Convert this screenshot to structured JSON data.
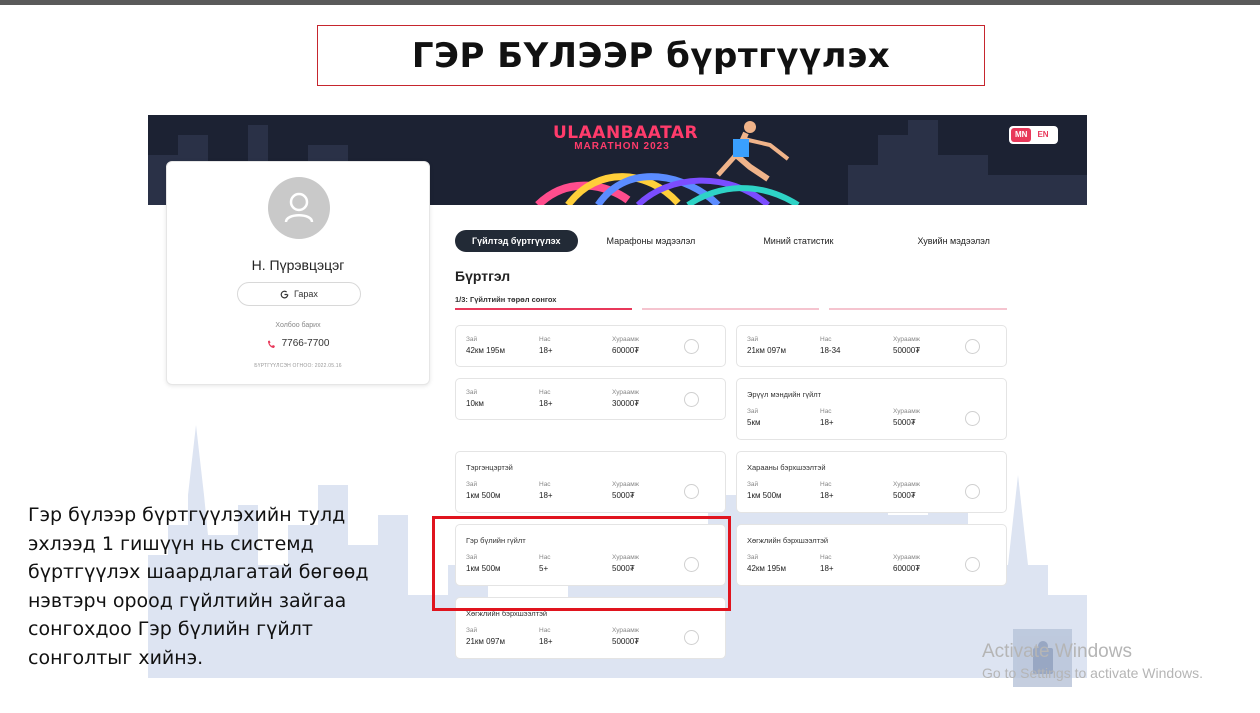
{
  "slide": {
    "title": "ГЭР БҮЛЭЭР бүртгүүлэх",
    "description": "Гэр бүлээр бүртгүүлэхийн тулд эхлээд 1 гишүүн нь системд бүртгүүлэх шаардлагатай бөгөөд нэвтэрч ороод гүйлтийн зайгаа сонгохдоо Гэр бүлийн гүйлт сонголтыг хийнэ."
  },
  "banner": {
    "logo_line1": "ULAANBAATAR",
    "logo_line2": "MARATHON 2023",
    "lang_mn": "MN",
    "lang_en": "EN"
  },
  "profile": {
    "name": "Н. Пүрэвцэцэг",
    "logout_label": "Гарах",
    "contact_label": "Холбоо барих",
    "phone": "7766-7700",
    "registered": "БҮРТГҮҮЛСЭН ОГНОО: 2022.05.16"
  },
  "tabs": [
    {
      "label": "Гүйлтэд бүртгүүлэх",
      "active": true
    },
    {
      "label": "Марафоны мэдээлэл",
      "active": false
    },
    {
      "label": "Миний статистик",
      "active": false
    },
    {
      "label": "Хувийн мэдээлэл",
      "active": false
    }
  ],
  "registration": {
    "title": "Бүртгэл",
    "step_label": "1/3: Гүйлтийн төрөл сонгох",
    "labels": {
      "distance": "Зай",
      "age": "Нас",
      "fee": "Хураамж"
    },
    "races": [
      {
        "title": "",
        "distance": "42км 195м",
        "age": "18+",
        "fee": "60000₮"
      },
      {
        "title": "",
        "distance": "21км 097м",
        "age": "18-34",
        "fee": "50000₮"
      },
      {
        "title": "",
        "distance": "10км",
        "age": "18+",
        "fee": "30000₮"
      },
      {
        "title": "Эрүүл мэндийн гүйлт",
        "distance": "5км",
        "age": "18+",
        "fee": "5000₮"
      },
      {
        "title": "Тэргэнцэртэй",
        "distance": "1км 500м",
        "age": "18+",
        "fee": "5000₮"
      },
      {
        "title": "Харааны бэрхшээлтэй",
        "distance": "1км 500м",
        "age": "18+",
        "fee": "5000₮"
      },
      {
        "title": "Гэр бүлийн гүйлт",
        "distance": "1км 500м",
        "age": "5+",
        "fee": "5000₮"
      },
      {
        "title": "Хөгжлийн бэрхшээлтэй",
        "distance": "42км 195м",
        "age": "18+",
        "fee": "60000₮"
      },
      {
        "title": "Хөгжлийн бэрхшээлтэй",
        "distance": "21км 097м",
        "age": "18+",
        "fee": "50000₮"
      }
    ]
  },
  "watermark": {
    "line1": "Activate Windows",
    "line2": "Go to Settings to activate Windows."
  },
  "colors": {
    "accent": "#e8385a",
    "highlight": "#e0141e",
    "dark": "#222a36",
    "banner": "#1c2233"
  }
}
